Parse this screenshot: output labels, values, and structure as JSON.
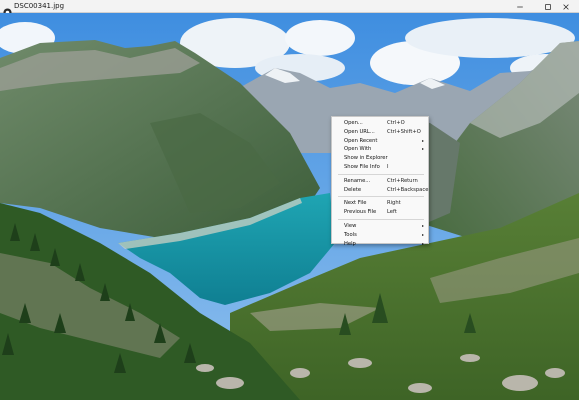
{
  "window": {
    "title": "DSC00341.jpg",
    "icons": {
      "app": "image-viewer-icon",
      "minimize": "minimize-icon",
      "maximize": "maximize-icon",
      "close": "close-icon"
    }
  },
  "viewer": {
    "image": "mountain-lake-photo"
  },
  "context_menu": {
    "groups": [
      [
        {
          "label": "Open...",
          "shortcut": "Ctrl+O"
        },
        {
          "label": "Open URL...",
          "shortcut": "Ctrl+Shift+O"
        },
        {
          "label": "Open Recent",
          "submenu": true
        },
        {
          "label": "Open With",
          "submenu": true
        },
        {
          "label": "Show in Explorer"
        },
        {
          "label": "Show File Info",
          "shortcut": "I"
        }
      ],
      [
        {
          "label": "Rename...",
          "shortcut": "Ctrl+Return"
        },
        {
          "label": "Delete",
          "shortcut": "Ctrl+Backspace"
        }
      ],
      [
        {
          "label": "Next File",
          "shortcut": "Right"
        },
        {
          "label": "Previous File",
          "shortcut": "Left"
        }
      ],
      [
        {
          "label": "View",
          "submenu": true
        },
        {
          "label": "Tools",
          "submenu": true
        },
        {
          "label": "Help",
          "submenu": true
        }
      ]
    ]
  }
}
